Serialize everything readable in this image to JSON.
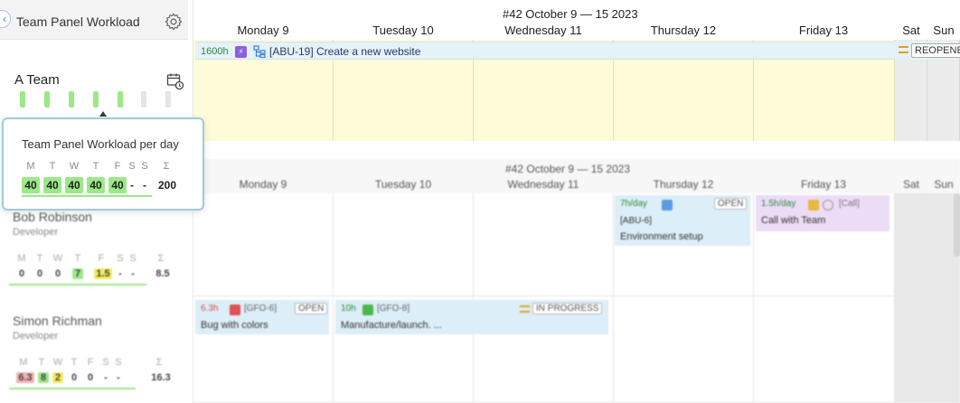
{
  "panel": {
    "title": "Team Panel Workload",
    "collapse_glyph": "‹",
    "team_name": "A Team"
  },
  "tooltip": {
    "title": "Team Panel Workload per day",
    "day_letters": [
      "M",
      "T",
      "W",
      "T",
      "F",
      "S",
      "S",
      "Σ"
    ],
    "values": [
      "40",
      "40",
      "40",
      "40",
      "40",
      "-",
      "-",
      "200"
    ]
  },
  "calendar_top": {
    "week": "#42 October 9 — 15 2023",
    "days": [
      "Monday 9",
      "Tuesday 10",
      "Wednesday 11",
      "Thursday 12",
      "Friday 13",
      "Sat",
      "Sun"
    ],
    "task": {
      "hours": "1600h",
      "label": "[ABU-19] Create a new website",
      "status": "REOPENED"
    }
  },
  "people": [
    {
      "name": "Bob Robinson",
      "role": "Developer",
      "day_letters": [
        "M",
        "T",
        "W",
        "T",
        "F",
        "S",
        "S",
        "Σ"
      ],
      "values": [
        "0",
        "0",
        "0",
        "7",
        "1.5",
        "-",
        "-",
        "8.5"
      ]
    },
    {
      "name": "Simon Richman",
      "role": "Developer",
      "day_letters": [
        "M",
        "T",
        "W",
        "T",
        "F",
        "S",
        "S",
        "Σ"
      ],
      "values": [
        "6.3",
        "8",
        "2",
        "0",
        "0",
        "-",
        "-",
        "16.3"
      ]
    }
  ],
  "calendar_bottom": {
    "week": "#42 October 9 — 15 2023",
    "days": [
      "Monday 9",
      "Tuesday 10",
      "Wednesday 11",
      "Thursday 12",
      "Friday 13",
      "Sat",
      "Sun"
    ],
    "events": {
      "bob_thu": {
        "hours": "7h/day",
        "code": "[ABU-6]",
        "title": "Environment setup",
        "status": "OPEN"
      },
      "bob_fri": {
        "hours": "1.5h/day",
        "title": "Call with Team",
        "tag": "[Call]"
      },
      "simon_mon": {
        "hours": "6.3h",
        "code": "[GFO-6]",
        "title": "Bug with colors",
        "status": "OPEN"
      },
      "simon_tue": {
        "hours": "10h",
        "code": "[GFO-8]",
        "title": "Manufacture/launch. ...",
        "status": "IN PROGRESS"
      }
    }
  },
  "colors": {
    "green": "#9be889",
    "yellow_cell": "#fdfbd8",
    "task_bar": "#e5f2f8",
    "accent_blue": "#3a7bd5",
    "bolt_purple": "#8c5fe0"
  }
}
